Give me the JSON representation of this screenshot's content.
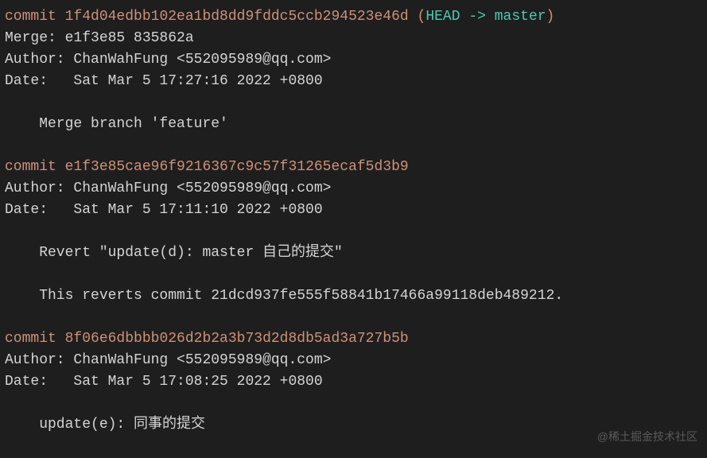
{
  "commits": [
    {
      "commit_label": "commit ",
      "hash": "1f4d04edbb102ea1bd8dd9fddc5ccb294523e46d",
      "ref_open": " (",
      "head": "HEAD -> ",
      "branch": "master",
      "ref_close": ")",
      "merge": "Merge: e1f3e85 835862a",
      "author": "Author: ChanWahFung <552095989@qq.com>",
      "date": "Date:   Sat Mar 5 17:27:16 2022 +0800",
      "messages": [
        "    Merge branch 'feature'"
      ]
    },
    {
      "commit_label": "commit ",
      "hash": "e1f3e85cae96f9216367c9c57f31265ecaf5d3b9",
      "author": "Author: ChanWahFung <552095989@qq.com>",
      "date": "Date:   Sat Mar 5 17:11:10 2022 +0800",
      "messages": [
        "    Revert \"update(d): master 自己的提交\"",
        "",
        "    This reverts commit 21dcd937fe555f58841b17466a99118deb489212."
      ]
    },
    {
      "commit_label": "commit ",
      "hash": "8f06e6dbbbb026d2b2a3b73d2d8db5ad3a727b5b",
      "author": "Author: ChanWahFung <552095989@qq.com>",
      "date": "Date:   Sat Mar 5 17:08:25 2022 +0800",
      "messages": [
        "    update(e): 同事的提交"
      ]
    }
  ],
  "watermark": "@稀土掘金技术社区"
}
